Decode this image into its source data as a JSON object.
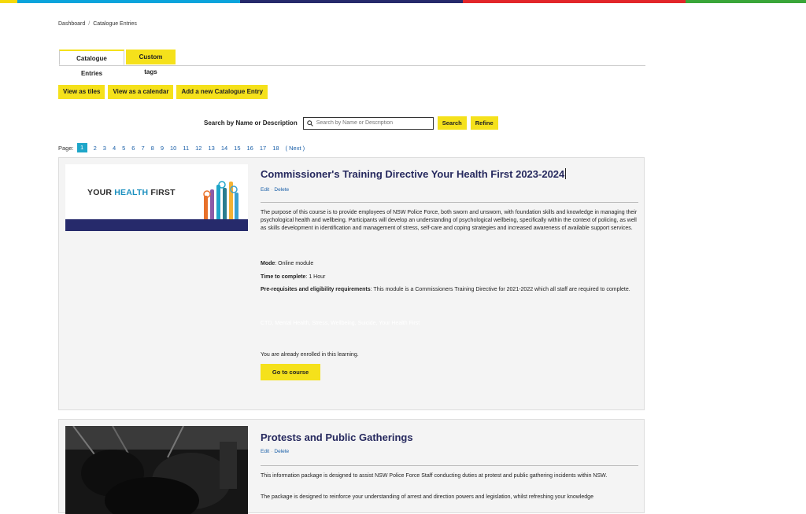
{
  "top_bar_colors": [
    "#f5d90a",
    "#0aa4dc",
    "#262a6b",
    "#e2262a",
    "#3aa639"
  ],
  "breadcrumb": {
    "items": [
      "Dashboard",
      "Catalogue Entries"
    ],
    "separator": "/"
  },
  "tabs": [
    {
      "label": "Catalogue Entries",
      "active": true
    },
    {
      "label": "Custom tags",
      "active": false
    }
  ],
  "view_buttons": [
    "View as tiles",
    "View as a calendar",
    "Add a new Catalogue Entry"
  ],
  "search": {
    "label": "Search by Name or Description",
    "placeholder": "Search by Name or Description",
    "search_button": "Search",
    "refine_button": "Refine"
  },
  "pagination": {
    "label": "Page:",
    "pages": [
      "1",
      "2",
      "3",
      "4",
      "5",
      "6",
      "7",
      "8",
      "9",
      "10",
      "11",
      "12",
      "13",
      "14",
      "15",
      "16",
      "17",
      "18"
    ],
    "current": "1",
    "next": "( Next )"
  },
  "entries": [
    {
      "title": "Commissioner's Training Directive Your Health First 2023-2024",
      "edit": "Edit",
      "delete": "Delete",
      "image_text_prefix": "YOUR",
      "image_text_highlight": "HEALTH",
      "image_text_suffix": "FIRST",
      "description": "The purpose of this course is to provide employees of NSW Police Force, both sworn and unsworn, with foundation skills and knowledge in managing their psychological health and wellbeing. Participants will develop an understanding of psychological wellbeing, specifically within the context of policing, as well as skills development in identification and management of stress, self-care and coping strategies and increased awareness of available support services.",
      "mode_label": "Mode",
      "mode_value": ": Online module",
      "time_label": "Time to complete",
      "time_value": ": 1 Hour",
      "prereq_label": "Pre-requisites and eligibility requirements",
      "prereq_value": ": This module is a Commissioners Training Directive for 2021-2022 which all staff are required to complete.",
      "tags_line": "CTD, Mental Health, Stress, Wellbeing, Suicide, Your Health First",
      "enrolled_text": "You are already enrolled in this learning.",
      "go_button": "Go to course"
    },
    {
      "title": "Protests and Public Gatherings",
      "edit": "Edit",
      "delete": "Delete",
      "description_1": "This information package is designed to assist NSW Police Force Staff conducting duties at protest and public gathering incidents within NSW.",
      "description_2": "The package is designed to reinforce your understanding of arrest and direction powers and legislation, whilst refreshing your knowledge"
    }
  ]
}
